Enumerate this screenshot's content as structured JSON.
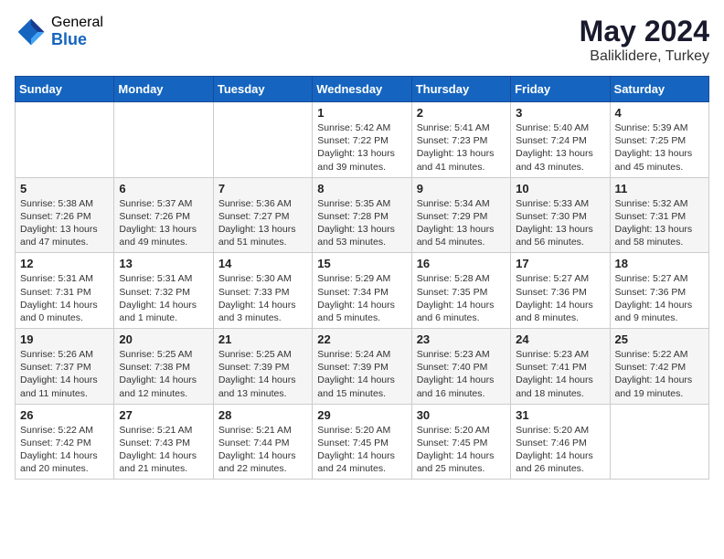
{
  "header": {
    "logo_general": "General",
    "logo_blue": "Blue",
    "month_year": "May 2024",
    "location": "Baliklidere, Turkey"
  },
  "weekdays": [
    "Sunday",
    "Monday",
    "Tuesday",
    "Wednesday",
    "Thursday",
    "Friday",
    "Saturday"
  ],
  "weeks": [
    [
      {
        "day": "",
        "info": ""
      },
      {
        "day": "",
        "info": ""
      },
      {
        "day": "",
        "info": ""
      },
      {
        "day": "1",
        "info": "Sunrise: 5:42 AM\nSunset: 7:22 PM\nDaylight: 13 hours\nand 39 minutes."
      },
      {
        "day": "2",
        "info": "Sunrise: 5:41 AM\nSunset: 7:23 PM\nDaylight: 13 hours\nand 41 minutes."
      },
      {
        "day": "3",
        "info": "Sunrise: 5:40 AM\nSunset: 7:24 PM\nDaylight: 13 hours\nand 43 minutes."
      },
      {
        "day": "4",
        "info": "Sunrise: 5:39 AM\nSunset: 7:25 PM\nDaylight: 13 hours\nand 45 minutes."
      }
    ],
    [
      {
        "day": "5",
        "info": "Sunrise: 5:38 AM\nSunset: 7:26 PM\nDaylight: 13 hours\nand 47 minutes."
      },
      {
        "day": "6",
        "info": "Sunrise: 5:37 AM\nSunset: 7:26 PM\nDaylight: 13 hours\nand 49 minutes."
      },
      {
        "day": "7",
        "info": "Sunrise: 5:36 AM\nSunset: 7:27 PM\nDaylight: 13 hours\nand 51 minutes."
      },
      {
        "day": "8",
        "info": "Sunrise: 5:35 AM\nSunset: 7:28 PM\nDaylight: 13 hours\nand 53 minutes."
      },
      {
        "day": "9",
        "info": "Sunrise: 5:34 AM\nSunset: 7:29 PM\nDaylight: 13 hours\nand 54 minutes."
      },
      {
        "day": "10",
        "info": "Sunrise: 5:33 AM\nSunset: 7:30 PM\nDaylight: 13 hours\nand 56 minutes."
      },
      {
        "day": "11",
        "info": "Sunrise: 5:32 AM\nSunset: 7:31 PM\nDaylight: 13 hours\nand 58 minutes."
      }
    ],
    [
      {
        "day": "12",
        "info": "Sunrise: 5:31 AM\nSunset: 7:31 PM\nDaylight: 14 hours\nand 0 minutes."
      },
      {
        "day": "13",
        "info": "Sunrise: 5:31 AM\nSunset: 7:32 PM\nDaylight: 14 hours\nand 1 minute."
      },
      {
        "day": "14",
        "info": "Sunrise: 5:30 AM\nSunset: 7:33 PM\nDaylight: 14 hours\nand 3 minutes."
      },
      {
        "day": "15",
        "info": "Sunrise: 5:29 AM\nSunset: 7:34 PM\nDaylight: 14 hours\nand 5 minutes."
      },
      {
        "day": "16",
        "info": "Sunrise: 5:28 AM\nSunset: 7:35 PM\nDaylight: 14 hours\nand 6 minutes."
      },
      {
        "day": "17",
        "info": "Sunrise: 5:27 AM\nSunset: 7:36 PM\nDaylight: 14 hours\nand 8 minutes."
      },
      {
        "day": "18",
        "info": "Sunrise: 5:27 AM\nSunset: 7:36 PM\nDaylight: 14 hours\nand 9 minutes."
      }
    ],
    [
      {
        "day": "19",
        "info": "Sunrise: 5:26 AM\nSunset: 7:37 PM\nDaylight: 14 hours\nand 11 minutes."
      },
      {
        "day": "20",
        "info": "Sunrise: 5:25 AM\nSunset: 7:38 PM\nDaylight: 14 hours\nand 12 minutes."
      },
      {
        "day": "21",
        "info": "Sunrise: 5:25 AM\nSunset: 7:39 PM\nDaylight: 14 hours\nand 13 minutes."
      },
      {
        "day": "22",
        "info": "Sunrise: 5:24 AM\nSunset: 7:39 PM\nDaylight: 14 hours\nand 15 minutes."
      },
      {
        "day": "23",
        "info": "Sunrise: 5:23 AM\nSunset: 7:40 PM\nDaylight: 14 hours\nand 16 minutes."
      },
      {
        "day": "24",
        "info": "Sunrise: 5:23 AM\nSunset: 7:41 PM\nDaylight: 14 hours\nand 18 minutes."
      },
      {
        "day": "25",
        "info": "Sunrise: 5:22 AM\nSunset: 7:42 PM\nDaylight: 14 hours\nand 19 minutes."
      }
    ],
    [
      {
        "day": "26",
        "info": "Sunrise: 5:22 AM\nSunset: 7:42 PM\nDaylight: 14 hours\nand 20 minutes."
      },
      {
        "day": "27",
        "info": "Sunrise: 5:21 AM\nSunset: 7:43 PM\nDaylight: 14 hours\nand 21 minutes."
      },
      {
        "day": "28",
        "info": "Sunrise: 5:21 AM\nSunset: 7:44 PM\nDaylight: 14 hours\nand 22 minutes."
      },
      {
        "day": "29",
        "info": "Sunrise: 5:20 AM\nSunset: 7:45 PM\nDaylight: 14 hours\nand 24 minutes."
      },
      {
        "day": "30",
        "info": "Sunrise: 5:20 AM\nSunset: 7:45 PM\nDaylight: 14 hours\nand 25 minutes."
      },
      {
        "day": "31",
        "info": "Sunrise: 5:20 AM\nSunset: 7:46 PM\nDaylight: 14 hours\nand 26 minutes."
      },
      {
        "day": "",
        "info": ""
      }
    ]
  ]
}
